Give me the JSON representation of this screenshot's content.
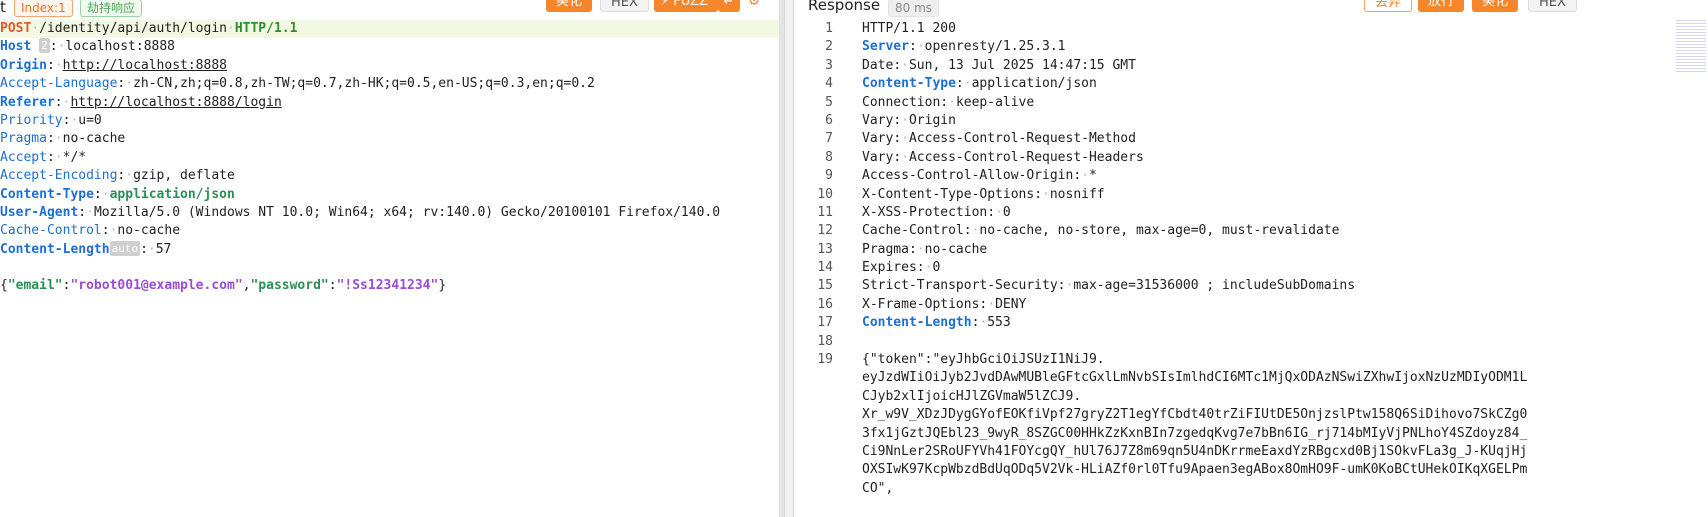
{
  "request": {
    "toolbar": {
      "title_fragment": "t",
      "index_tag": "Index:1",
      "hold_tag": "劫持响应",
      "beautify": "美化",
      "hex": "HEX",
      "fuzz": "FUZZ"
    },
    "request_line": {
      "method": "POST",
      "path": "/identity/api/auth/login",
      "protocol": "HTTP/1.1"
    },
    "headers": [
      {
        "name": "Host",
        "value": "localhost:8888",
        "chip": "2"
      },
      {
        "name": "Origin",
        "value": "http://localhost:8888"
      },
      {
        "name": "Accept-Language",
        "value": "zh-CN,zh;q=0.8,zh-TW;q=0.7,zh-HK;q=0.5,en-US;q=0.3,en;q=0.2"
      },
      {
        "name": "Referer",
        "value": "http://localhost:8888/login"
      },
      {
        "name": "Priority",
        "value": "u=0"
      },
      {
        "name": "Pragma",
        "value": "no-cache"
      },
      {
        "name": "Accept",
        "value": "*/*"
      },
      {
        "name": "Accept-Encoding",
        "value": "gzip, deflate"
      },
      {
        "name": "Content-Type",
        "value": "application/json"
      },
      {
        "name": "User-Agent",
        "value": "Mozilla/5.0 (Windows NT 10.0; Win64; x64; rv:140.0) Gecko/20100101 Firefox/140.0"
      },
      {
        "name": "Cache-Control",
        "value": "no-cache"
      },
      {
        "name": "Content-Length",
        "value": "57",
        "chip": "auto"
      }
    ],
    "body": {
      "email_key": "\"email\"",
      "email_value": "\"robot001@example.com\"",
      "password_key": "\"password\"",
      "password_value": "\"!Ss12341234\""
    }
  },
  "response": {
    "toolbar": {
      "title": "Response",
      "time_tag": "80 ms",
      "discard": "丢弃",
      "release": "放行",
      "beautify": "美化",
      "hex": "HEX"
    },
    "lines": [
      {
        "n": "1",
        "text": "HTTP/1.1 200"
      },
      {
        "n": "2",
        "key": "Server",
        "value": "openresty/1.25.3.1",
        "bold": true
      },
      {
        "n": "3",
        "key": "Date",
        "value": "Sun, 13 Jul 2025 14:47:15 GMT"
      },
      {
        "n": "4",
        "key": "Content-Type",
        "value": "application/json",
        "bold": true
      },
      {
        "n": "5",
        "key": "Connection",
        "value": "keep-alive"
      },
      {
        "n": "6",
        "key": "Vary",
        "value": "Origin"
      },
      {
        "n": "7",
        "key": "Vary",
        "value": "Access-Control-Request-Method"
      },
      {
        "n": "8",
        "key": "Vary",
        "value": "Access-Control-Request-Headers"
      },
      {
        "n": "9",
        "key": "Access-Control-Allow-Origin",
        "value": "*"
      },
      {
        "n": "10",
        "key": "X-Content-Type-Options",
        "value": "nosniff"
      },
      {
        "n": "11",
        "key": "X-XSS-Protection",
        "value": "0"
      },
      {
        "n": "12",
        "key": "Cache-Control",
        "value": "no-cache, no-store, max-age=0, must-revalidate"
      },
      {
        "n": "13",
        "key": "Pragma",
        "value": "no-cache"
      },
      {
        "n": "14",
        "key": "Expires",
        "value": "0"
      },
      {
        "n": "15",
        "key": "Strict-Transport-Security",
        "value": "max-age=31536000 ; includeSubDomains"
      },
      {
        "n": "16",
        "key": "X-Frame-Options",
        "value": "DENY"
      },
      {
        "n": "17",
        "key": "Content-Length",
        "value": "553",
        "bold": true
      },
      {
        "n": "18",
        "text": ""
      }
    ],
    "body_line_number": "19",
    "body_text": "{\"token\":\"eyJhbGciOiJSUzI1NiJ9.\neyJzdWIiOiJyb2JvdDAwMUBleGFtcGxlLmNvbSIsImlhdCI6MTc1MjQxODAzNSwiZXhwIjoxNzUzMDIyODM1LCJyb2xlIjoicHJlZGVmaW5lZCJ9.\nXr_w9V_XDzJDygGYofEOKfiVpf27gryZ2T1egYfCbdt40trZiFIUtDE5OnjzslPtw158Q6SiDihovo7SkCZg03fx1jGztJQEbl23_9wyR_8SZGC00HHkZzKxnBIn7zgedqKvg7e7bBn6IG_rj714bMIyVjPNLhoY4SZdoyz84_Ci9NnLer2SRoUFYVh41FOYcgQY_hUl76J7Z8m69qn5U4nDKrrmeEaxdYzRBgcxd0Bj1SOkvFLa3g_J-KUqjHjOXSIwK97KcpWbzdBdUqODq5V2Vk-HLiAZf0rl0Tfu9Apaen3egABox8OmHO9F-umK0KoBCtUHekOIKqXGELPmCO\","
  }
}
